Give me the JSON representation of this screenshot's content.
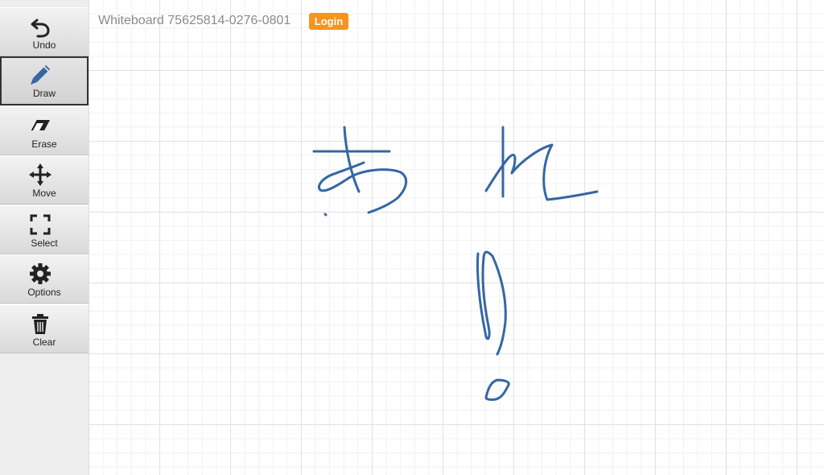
{
  "header": {
    "title": "Whiteboard 75625814-0276-0801",
    "login_label": "Login"
  },
  "toolbar": {
    "active_tool": "Draw",
    "tools": [
      {
        "label": "Undo",
        "icon": "undo-icon"
      },
      {
        "label": "Draw",
        "icon": "pencil-icon"
      },
      {
        "label": "Erase",
        "icon": "eraser-icon"
      },
      {
        "label": "Move",
        "icon": "move-arrows-icon"
      },
      {
        "label": "Select",
        "icon": "select-corners-icon"
      },
      {
        "label": "Options",
        "icon": "gear-icon"
      },
      {
        "label": "Clear",
        "icon": "trash-icon"
      }
    ]
  },
  "canvas": {
    "grid": true,
    "stroke_color": "#3566a5"
  },
  "colors": {
    "login_button": "#f7941d",
    "title_text": "#8a8a8a",
    "sidebar_bg": "#eeeeee"
  }
}
